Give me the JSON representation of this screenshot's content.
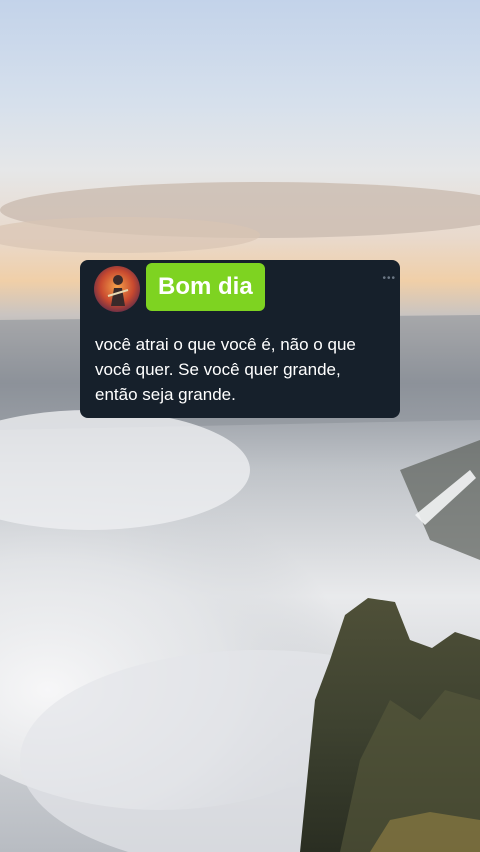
{
  "post": {
    "avatar_icon": "user-avatar-photo",
    "greeting": "Bom dia",
    "more_icon": "more-dots-icon",
    "quote_lines": [
      "você atrai o que você é, não o que",
      "você quer. Se você quer grande,",
      "então seja grande."
    ]
  },
  "colors": {
    "card_background": "#16202b",
    "badge_green": "#7ed321"
  }
}
